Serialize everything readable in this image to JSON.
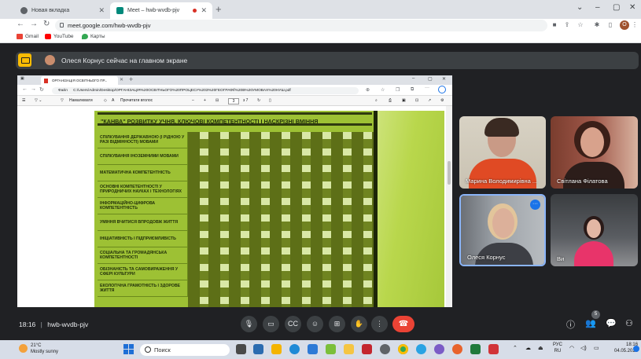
{
  "browser": {
    "tabs": [
      {
        "label": "Новая вкладка"
      },
      {
        "label": "Meet – hwb-wvdb-pjv"
      }
    ],
    "url": "meet.google.com/hwb-wvdb-pjv",
    "bookmarks": [
      "Gmail",
      "YouTube",
      "Карты"
    ],
    "profile_initial": "О"
  },
  "meet": {
    "presenter_banner": "Олеся Корнус сейчас на главном экране",
    "meeting_time": "18:16",
    "meeting_code": "hwb-wvdb-pjv",
    "participants_count": "5",
    "participants": [
      {
        "name": "Марина Володимирівна ..."
      },
      {
        "name": "Світлана Філатова"
      },
      {
        "name": "Олеся Корнус"
      },
      {
        "name": "Ви"
      }
    ]
  },
  "shared_screen": {
    "tab_label": "ОРГАНІЗАЦІЯ ОСВІТНЬОГО ПР...",
    "address": "C:/Users/Admin/Desktop/ОРГАНІЗАЦІЯ%20ОСВІТНЬОГО%20ПРОЦЕСУ%20З%20ГЕОГРАФІЇ%20В%20УМОВАХ%20НУШ.pdf",
    "file_label": "Файл",
    "draw_label": "Намалювати",
    "read_aloud_label": "Прочитати вголос",
    "page_current": "3",
    "page_total": "з 7",
    "slide": {
      "title": "\"КАНВА\" РОЗВИТКУ УЧНЯ. КЛЮЧОВІ КОМПЕТЕНТНОСТІ І НАСКРІЗНІ ВМІННЯ",
      "rows": [
        "Спілкування державною (і рідною у разі відмінності) мовами",
        "Спілкування іноземними мовами",
        "Математична компетентність",
        "Основні компетентності у природничих науках і технологіях",
        "Інформаційно-цифрова компетентність",
        "Уміння вчитися впродовж життя",
        "Ініціативність і підприємливість",
        "Соціальна та громадянська компетентності",
        "Обізнаність та самовираження у сфері культури",
        "Екологічна грамотність і здорове життя"
      ]
    }
  },
  "taskbar": {
    "weather_temp": "21°C",
    "weather_desc": "Mostly sunny",
    "search_placeholder": "Поиск",
    "lang_top": "РУС",
    "lang_bottom": "RU",
    "time": "18:16",
    "date": "04.05.2023"
  }
}
